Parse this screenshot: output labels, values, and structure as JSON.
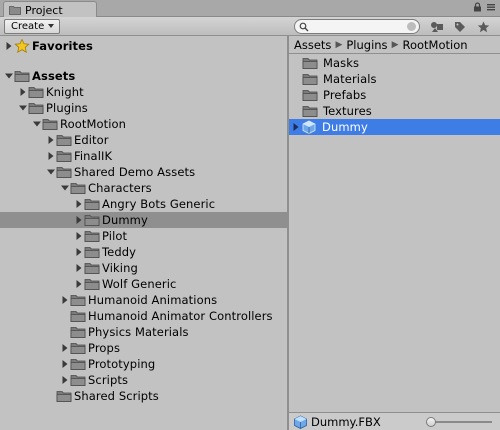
{
  "tab": {
    "label": "Project",
    "icon": "folder-icon"
  },
  "toolbar": {
    "create_label": "Create",
    "search_value": "",
    "search_placeholder": ""
  },
  "tree": [
    {
      "label": "Favorites",
      "indent": 0,
      "arrow": "collapsed",
      "icon": "star-icon",
      "bold": true
    },
    {
      "label": "Assets",
      "indent": 0,
      "arrow": "expanded",
      "icon": "folder-icon",
      "bold": true
    },
    {
      "label": "Knight",
      "indent": 1,
      "arrow": "collapsed",
      "icon": "folder-icon"
    },
    {
      "label": "Plugins",
      "indent": 1,
      "arrow": "expanded",
      "icon": "folder-icon"
    },
    {
      "label": "RootMotion",
      "indent": 2,
      "arrow": "expanded",
      "icon": "folder-icon"
    },
    {
      "label": "Editor",
      "indent": 3,
      "arrow": "collapsed",
      "icon": "folder-icon"
    },
    {
      "label": "FinalIK",
      "indent": 3,
      "arrow": "collapsed",
      "icon": "folder-icon"
    },
    {
      "label": "Shared Demo Assets",
      "indent": 3,
      "arrow": "expanded",
      "icon": "folder-icon"
    },
    {
      "label": "Characters",
      "indent": 4,
      "arrow": "expanded",
      "icon": "folder-icon"
    },
    {
      "label": "Angry Bots Generic",
      "indent": 5,
      "arrow": "collapsed",
      "icon": "folder-icon"
    },
    {
      "label": "Dummy",
      "indent": 5,
      "arrow": "collapsed",
      "icon": "folder-icon",
      "selected": true
    },
    {
      "label": "Pilot",
      "indent": 5,
      "arrow": "collapsed",
      "icon": "folder-icon"
    },
    {
      "label": "Teddy",
      "indent": 5,
      "arrow": "collapsed",
      "icon": "folder-icon"
    },
    {
      "label": "Viking",
      "indent": 5,
      "arrow": "collapsed",
      "icon": "folder-icon"
    },
    {
      "label": "Wolf Generic",
      "indent": 5,
      "arrow": "collapsed",
      "icon": "folder-icon"
    },
    {
      "label": "Humanoid Animations",
      "indent": 4,
      "arrow": "collapsed",
      "icon": "folder-icon"
    },
    {
      "label": "Humanoid Animator Controllers",
      "indent": 4,
      "arrow": "none",
      "icon": "folder-icon"
    },
    {
      "label": "Physics Materials",
      "indent": 4,
      "arrow": "none",
      "icon": "folder-icon"
    },
    {
      "label": "Props",
      "indent": 4,
      "arrow": "collapsed",
      "icon": "folder-icon"
    },
    {
      "label": "Prototyping",
      "indent": 4,
      "arrow": "collapsed",
      "icon": "folder-icon"
    },
    {
      "label": "Scripts",
      "indent": 4,
      "arrow": "collapsed",
      "icon": "folder-icon"
    },
    {
      "label": "Shared Scripts",
      "indent": 3,
      "arrow": "none",
      "icon": "folder-icon"
    }
  ],
  "breadcrumb": [
    "Assets",
    "Plugins",
    "RootMotion"
  ],
  "files": [
    {
      "label": "Masks",
      "icon": "folder-icon"
    },
    {
      "label": "Materials",
      "icon": "folder-icon"
    },
    {
      "label": "Prefabs",
      "icon": "folder-icon"
    },
    {
      "label": "Textures",
      "icon": "folder-icon"
    },
    {
      "label": "Dummy",
      "icon": "model-prefab-icon",
      "selected": true,
      "arrow": "collapsed"
    }
  ],
  "status": {
    "label": "Dummy.FBX",
    "icon": "model-icon",
    "zoom": 0.0
  },
  "colors": {
    "selection": "#3e7ce6",
    "tree_selection": "#8f8f8f",
    "background": "#c2c2c2"
  }
}
